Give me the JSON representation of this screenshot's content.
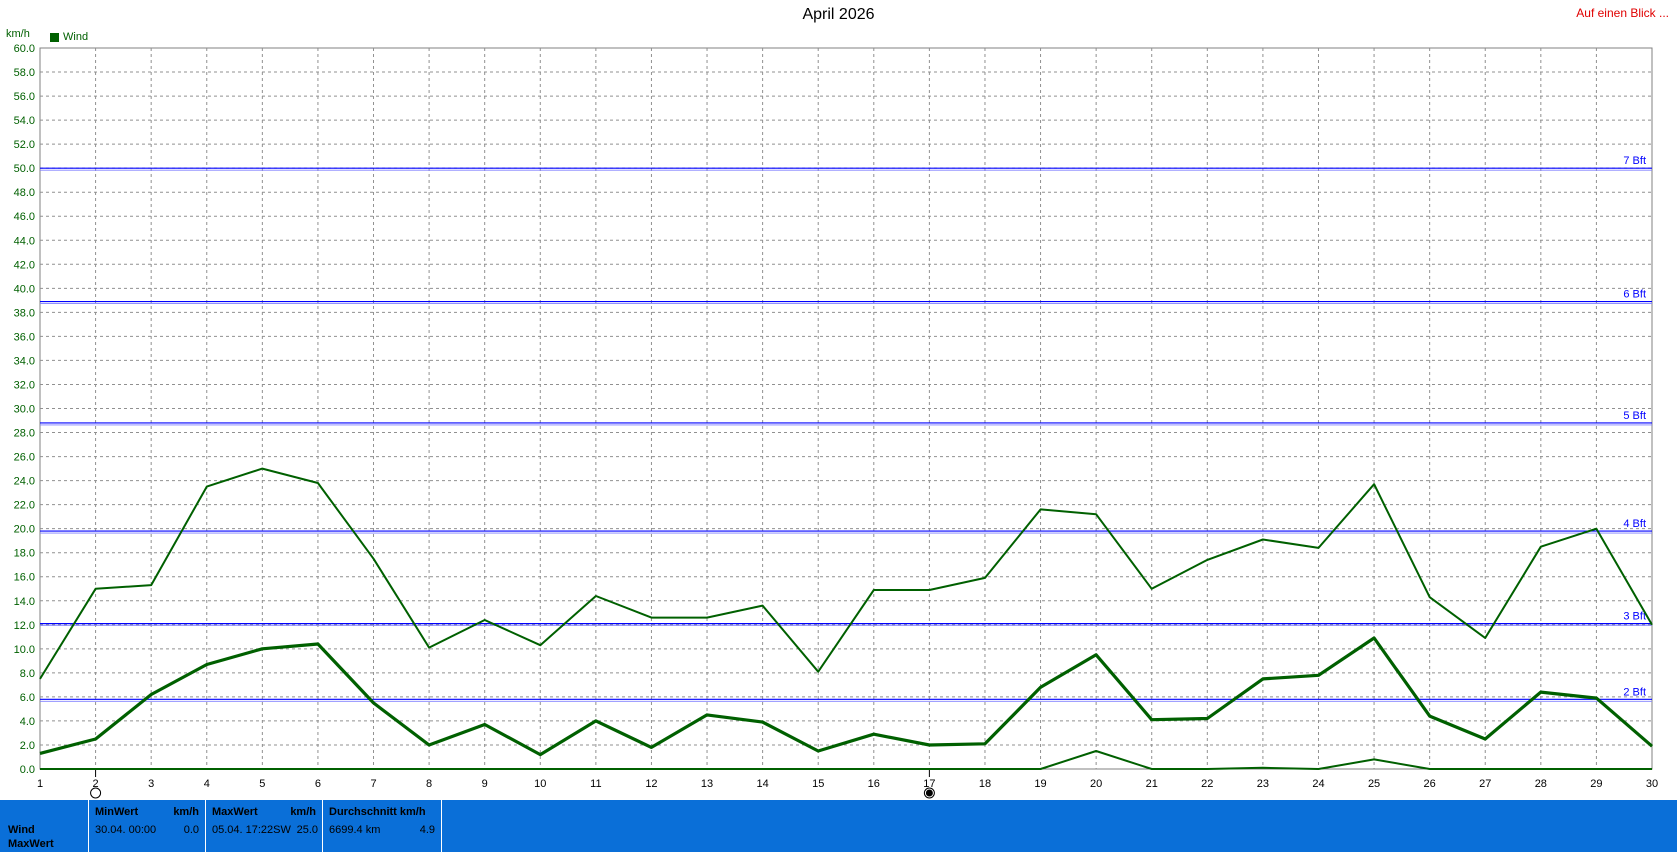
{
  "header": {
    "title": "April 2026",
    "glance_link": "Auf einen Blick ...",
    "unit": "km/h",
    "legend": "Wind"
  },
  "colors": {
    "line": "#006000",
    "beaufort": "#0000ff",
    "footer": "#0a6fd8",
    "link": "#e00000"
  },
  "chart_data": {
    "type": "line",
    "title": "April 2026",
    "ylabel": "km/h",
    "xlim": [
      1,
      30
    ],
    "ylim": [
      0,
      60
    ],
    "y_tick_step": 2,
    "x": [
      1,
      2,
      3,
      4,
      5,
      6,
      7,
      8,
      9,
      10,
      11,
      12,
      13,
      14,
      15,
      16,
      17,
      18,
      19,
      20,
      21,
      22,
      23,
      24,
      25,
      26,
      27,
      28,
      29,
      30
    ],
    "series": [
      {
        "name": "Wind",
        "role": "max",
        "values": [
          7.5,
          15.0,
          15.3,
          23.5,
          25.0,
          23.8,
          17.5,
          10.1,
          12.4,
          10.3,
          14.4,
          12.6,
          12.6,
          13.6,
          8.1,
          14.9,
          14.9,
          15.9,
          21.6,
          21.2,
          15.0,
          17.4,
          19.1,
          18.4,
          23.7,
          14.3,
          10.9,
          18.5,
          20.0,
          12.0
        ]
      },
      {
        "name": "",
        "role": "avg",
        "values": [
          1.3,
          2.5,
          6.2,
          8.7,
          10.0,
          10.4,
          5.5,
          2.0,
          3.7,
          1.2,
          4.0,
          1.8,
          4.5,
          3.9,
          1.5,
          2.9,
          2.0,
          2.1,
          6.8,
          9.5,
          4.1,
          4.2,
          7.5,
          7.8,
          10.9,
          4.4,
          2.5,
          6.4,
          5.9,
          1.9
        ]
      },
      {
        "name": "",
        "role": "min",
        "values": [
          0,
          0,
          0,
          0,
          0,
          0,
          0,
          0,
          0,
          0,
          0,
          0,
          0,
          0,
          0,
          0,
          0,
          0,
          0,
          1.5,
          0,
          0,
          0.1,
          0,
          0.8,
          0,
          0,
          0,
          0,
          0
        ]
      }
    ],
    "beaufort_lines": [
      {
        "label": "2 Bft",
        "value": 5.8
      },
      {
        "label": "3 Bft",
        "value": 12.1
      },
      {
        "label": "4 Bft",
        "value": 19.8
      },
      {
        "label": "5 Bft",
        "value": 28.8
      },
      {
        "label": "6 Bft",
        "value": 38.9
      },
      {
        "label": "7 Bft",
        "value": 50.0
      }
    ],
    "moon_markers": [
      {
        "day": 2,
        "phase": "full-moon"
      },
      {
        "day": 17,
        "phase": "new-moon"
      }
    ],
    "grid": true
  },
  "footer": {
    "row_labels": [
      "Wind",
      "MaxWert"
    ],
    "min": {
      "header": "MinWert",
      "unit": "km/h",
      "time": "30.04.  00:00",
      "value": "0.0"
    },
    "max": {
      "header": "MaxWert",
      "unit": "km/h",
      "time": "05.04.  17:22SW",
      "value": "25.0"
    },
    "avg": {
      "header": "Durchschnitt km/h",
      "distance": "6699.4 km",
      "value": "4.9"
    }
  }
}
